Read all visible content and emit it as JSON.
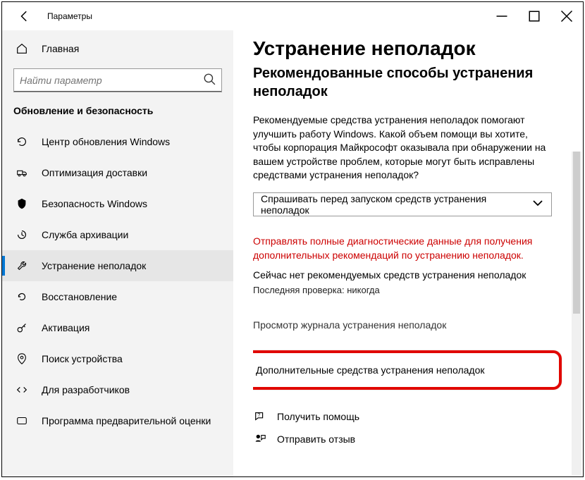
{
  "titlebar": {
    "app_title": "Параметры"
  },
  "sidebar": {
    "home_label": "Главная",
    "search_placeholder": "Найти параметр",
    "group_label": "Обновление и безопасность",
    "items": [
      {
        "label": "Центр обновления Windows"
      },
      {
        "label": "Оптимизация доставки"
      },
      {
        "label": "Безопасность Windows"
      },
      {
        "label": "Служба архивации"
      },
      {
        "label": "Устранение неполадок"
      },
      {
        "label": "Восстановление"
      },
      {
        "label": "Активация"
      },
      {
        "label": "Поиск устройства"
      },
      {
        "label": "Для разработчиков"
      },
      {
        "label": "Программа предварительной оценки"
      }
    ]
  },
  "main": {
    "title": "Устранение неполадок",
    "subtitle": "Рекомендованные способы устранения неполадок",
    "description": "Рекомендуемые средства устранения неполадок помогают улучшить работу Windows. Какой объем помощи вы хотите, чтобы корпорация Майкрософт оказывала при обнаружении на вашем устройстве проблем, которые могут быть исправлены средствами устранения неполадок?",
    "combo_value": "Спрашивать перед запуском средств устранения неполадок",
    "warning": "Отправлять полные диагностические данные для получения дополнительных рекомендаций по устранению неполадок.",
    "no_recs": "Сейчас нет рекомендуемых средств устранения неполадок",
    "last_check": "Последняя проверка: никогда",
    "history_link": "Просмотр журнала устранения неполадок",
    "more_tools": "Дополнительные средства устранения неполадок",
    "help_label": "Получить помощь",
    "feedback_label": "Отправить отзыв"
  }
}
